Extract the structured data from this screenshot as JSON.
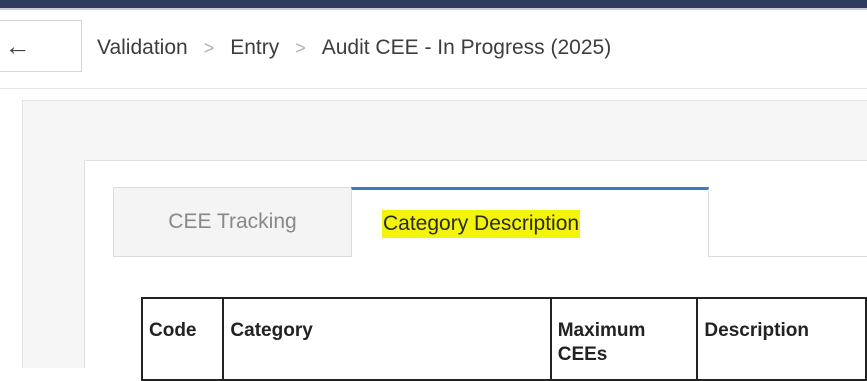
{
  "header": {
    "back_icon": "arrow-left-icon",
    "breadcrumb": [
      "Validation",
      "Entry",
      "Audit CEE - In Progress (2025)"
    ],
    "separator": ">"
  },
  "tabs": [
    {
      "label": "CEE Tracking",
      "active": false
    },
    {
      "label": "Category Description",
      "active": true,
      "highlighted": true
    }
  ],
  "table": {
    "columns": [
      "Code",
      "Category",
      "Maximum CEEs",
      "Description"
    ]
  },
  "colors": {
    "topbar": "#2e3b5e",
    "tab_accent": "#3b7dc4",
    "highlight": "#f4f40a"
  }
}
